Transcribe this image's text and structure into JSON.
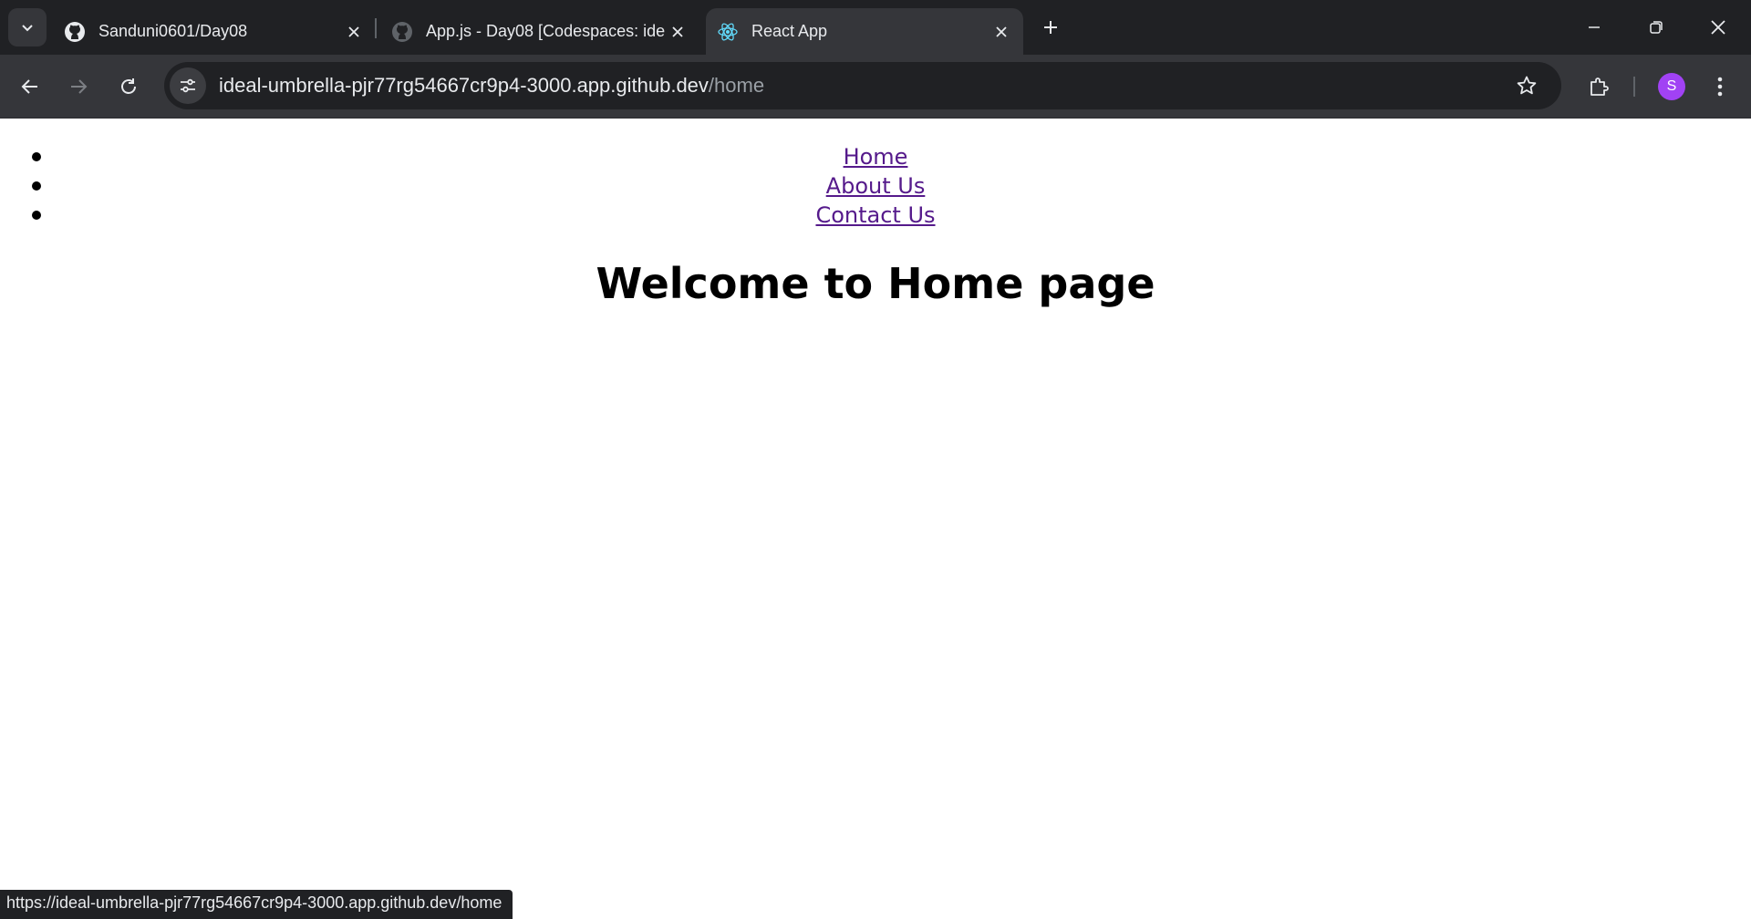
{
  "tabs": [
    {
      "title": "Sanduni0601/Day08",
      "icon": "github-icon",
      "active": false
    },
    {
      "title": "App.js - Day08 [Codespaces: ide",
      "icon": "github-icon",
      "active": false
    },
    {
      "title": "React App",
      "icon": "react-icon",
      "active": true
    }
  ],
  "address_bar": {
    "host": "ideal-umbrella-pjr77rg54667cr9p4-3000.app.github.dev",
    "path": "/home"
  },
  "profile": {
    "initial": "S",
    "color": "#a142f4"
  },
  "page": {
    "nav_links": [
      "Home",
      "About Us",
      "Contact Us"
    ],
    "heading": "Welcome to Home page"
  },
  "status_bar": {
    "url": "https://ideal-umbrella-pjr77rg54667cr9p4-3000.app.github.dev/home"
  }
}
